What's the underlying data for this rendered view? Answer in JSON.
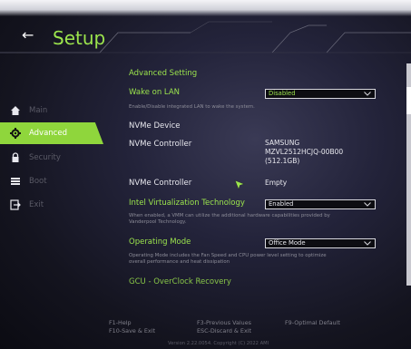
{
  "header": {
    "back_glyph": "←",
    "title": "Setup"
  },
  "nav": {
    "items": [
      {
        "label": "Main",
        "icon": "home-icon",
        "active": false
      },
      {
        "label": "Advanced",
        "icon": "gear-icon",
        "active": true
      },
      {
        "label": "Security",
        "icon": "lock-icon",
        "active": false
      },
      {
        "label": "Boot",
        "icon": "boot-icon",
        "active": false
      },
      {
        "label": "Exit",
        "icon": "exit-icon",
        "active": false
      }
    ]
  },
  "main": {
    "section_title": "Advanced Setting",
    "wake_on_lan": {
      "label": "Wake on LAN",
      "value": "Disabled",
      "description": "Enable/Disable integrated LAN to wake the system."
    },
    "nvme_device_label": "NVMe Device",
    "nvme_controller_1": {
      "label": "NVMe Controller",
      "value_line1": "SAMSUNG",
      "value_line2": "MZVL2512HCJQ-00B00",
      "value_line3": "(512.1GB)"
    },
    "nvme_controller_2": {
      "label": "NVMe Controller",
      "value": "Empty"
    },
    "virtualization": {
      "label": "Intel Virtualization Technology",
      "value": "Enabled",
      "description_line1": "When enabled, a VMM can utilize the additional hardware capabilities provided by",
      "description_line2": "Vanderpool Technology."
    },
    "operating_mode": {
      "label": "Operating Mode",
      "value": "Office Mode",
      "description_line1": "Operating Mode includes the Fan Speed and CPU power level setting to optimize",
      "description_line2": "overall performance and heat dissipation"
    },
    "gcu_label": "GCU - OverClock Recovery"
  },
  "footer": {
    "f1": "F1-Help",
    "f10": "F10-Save & Exit",
    "f3": "F3-Previous Values",
    "esc": "ESC-Discard & Exit",
    "f9": "F9-Optimal Default",
    "version": "Version 2.22.0054. Copyright (C) 2022 AMI"
  },
  "colors": {
    "accent": "#9ce54d",
    "active_nav": "#8fd63c"
  }
}
